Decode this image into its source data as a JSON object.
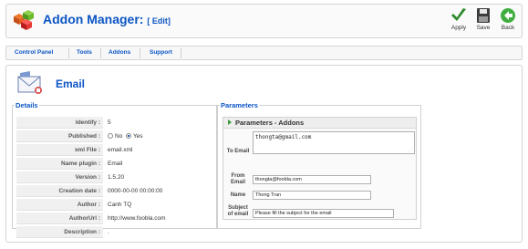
{
  "header": {
    "title": "Addon Manager:",
    "subtitle": "[ Edit]",
    "toolbar": {
      "apply": "Apply",
      "save": "Save",
      "back": "Back"
    }
  },
  "menu": [
    "Control Panel",
    "Tools",
    "Addons",
    "Support"
  ],
  "page": {
    "title": "Email"
  },
  "details": {
    "legend": "Details",
    "rows": [
      {
        "label": "Identify :",
        "value": "5"
      },
      {
        "label": "Published :",
        "no": "No",
        "yes": "Yes",
        "selected": "Yes"
      },
      {
        "label": "xml File :",
        "value": "email.xml"
      },
      {
        "label": "Name plugin :",
        "value": "Email"
      },
      {
        "label": "Version :",
        "value": "1.5.20"
      },
      {
        "label": "Creation date :",
        "value": "0000-00-00 00:00:00"
      },
      {
        "label": "Author :",
        "value": "Canh TQ"
      },
      {
        "label": "AuthorUrl :",
        "value": "http://www.foobla.com"
      },
      {
        "label": "Description :",
        "value": "."
      }
    ]
  },
  "parameters": {
    "legend": "Parameters",
    "panel_title": "Parameters - Addons",
    "to_email": {
      "label": "To Email",
      "value": "thongta@gmail.com"
    },
    "from_email": {
      "label": "From Email",
      "value": "thongta@foobla.com"
    },
    "name": {
      "label": "Name",
      "value": "Thong Tran"
    },
    "subject": {
      "label": "Subject of email",
      "value": "Please fill the subject for the email"
    }
  },
  "colors": {
    "accent": "#0b55c4",
    "panel_arrow": "#3b9a3b"
  },
  "icons": [
    "cubes-logo-icon",
    "apply-check-icon",
    "save-disk-icon",
    "back-arrow-icon",
    "email-envelope-icon"
  ]
}
